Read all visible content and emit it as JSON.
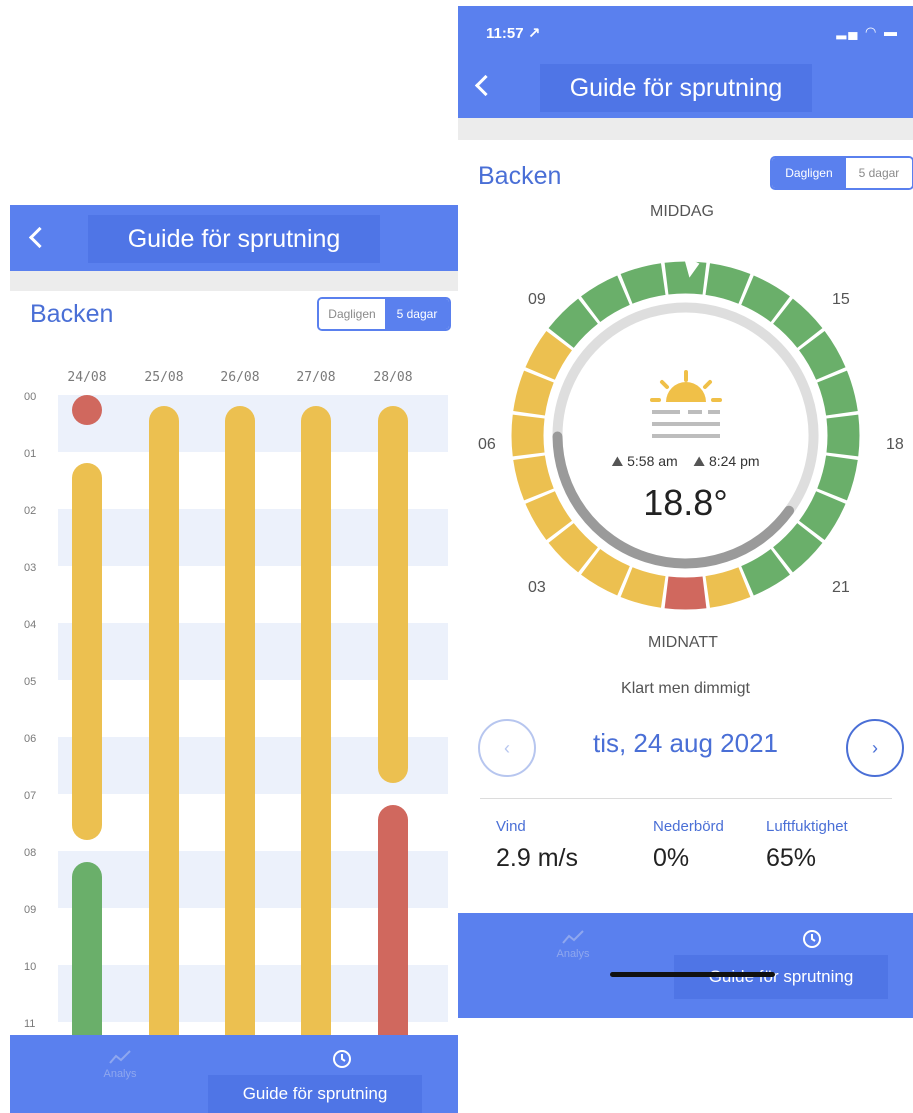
{
  "left": {
    "nav_title": "Guide för sprutning",
    "field_name": "Backen",
    "segment": {
      "daily": "Dagligen",
      "five_day": "5 dagar",
      "selected": "5 dagar"
    },
    "days": [
      "24/08",
      "25/08",
      "26/08",
      "27/08",
      "28/08"
    ],
    "hours": [
      "00",
      "01",
      "02",
      "03",
      "04",
      "05",
      "06",
      "07",
      "08",
      "09",
      "10",
      "11"
    ],
    "condition_colors": {
      "good": "#6aaf6a",
      "moderate": "#ecc050",
      "bad": "#d0685e"
    },
    "forecast": [
      {
        "day": "24/08",
        "segments": [
          {
            "from": 0.0,
            "to": 0.5,
            "status": "bad"
          },
          {
            "from": 1.2,
            "to": 7.8,
            "status": "moderate"
          },
          {
            "from": 8.2,
            "to": 11.5,
            "status": "good"
          }
        ]
      },
      {
        "day": "25/08",
        "segments": [
          {
            "from": 0.2,
            "to": 11.5,
            "status": "moderate"
          }
        ]
      },
      {
        "day": "26/08",
        "segments": [
          {
            "from": 0.2,
            "to": 11.5,
            "status": "moderate"
          }
        ]
      },
      {
        "day": "27/08",
        "segments": [
          {
            "from": 0.2,
            "to": 11.5,
            "status": "moderate"
          }
        ]
      },
      {
        "day": "28/08",
        "segments": [
          {
            "from": 0.2,
            "to": 6.8,
            "status": "moderate"
          },
          {
            "from": 7.2,
            "to": 11.5,
            "status": "bad"
          }
        ]
      }
    ],
    "tabs": {
      "analys": "Analys",
      "guide": "Guide för sprutning"
    }
  },
  "right": {
    "status_time": "11:57 ↗",
    "status_icons": "▂▄ ◠ ▬",
    "nav_title": "Guide för sprutning",
    "field_name": "Backen",
    "segment": {
      "daily": "Dagligen",
      "five_day": "5 dagar",
      "selected": "Dagligen"
    },
    "dial_labels": {
      "noon": "MIDDAG",
      "midnight": "MIDNATT",
      "h09": "09",
      "h15": "15",
      "h06": "06",
      "h18": "18",
      "h03": "03",
      "h21": "21"
    },
    "hourly_status": [
      "bad",
      "moderate",
      "moderate",
      "moderate",
      "moderate",
      "moderate",
      "moderate",
      "moderate",
      "moderate",
      "good",
      "good",
      "good",
      "good",
      "good",
      "good",
      "good",
      "good",
      "good",
      "good",
      "good",
      "good",
      "good",
      "good",
      "moderate"
    ],
    "colors": {
      "good": "#6aaf6a",
      "moderate": "#ecc050",
      "bad": "#d0685e",
      "daylight": "#dedede",
      "night": "#9a9a9a"
    },
    "weather_icon": "partly-sunny-fog-icon",
    "sunrise": "5:58 am",
    "sunset": "8:24 pm",
    "temperature": "18.8°",
    "description": "Klart men dimmigt",
    "date": "tis, 24 aug 2021",
    "stats": [
      {
        "label": "Vind",
        "value": "2.9  m/s"
      },
      {
        "label": "Nederbörd",
        "value": "0%"
      },
      {
        "label": "Luftfuktighet",
        "value": "65%"
      }
    ],
    "tabs": {
      "analys": "Analys",
      "guide": "Guide för sprutning"
    }
  }
}
